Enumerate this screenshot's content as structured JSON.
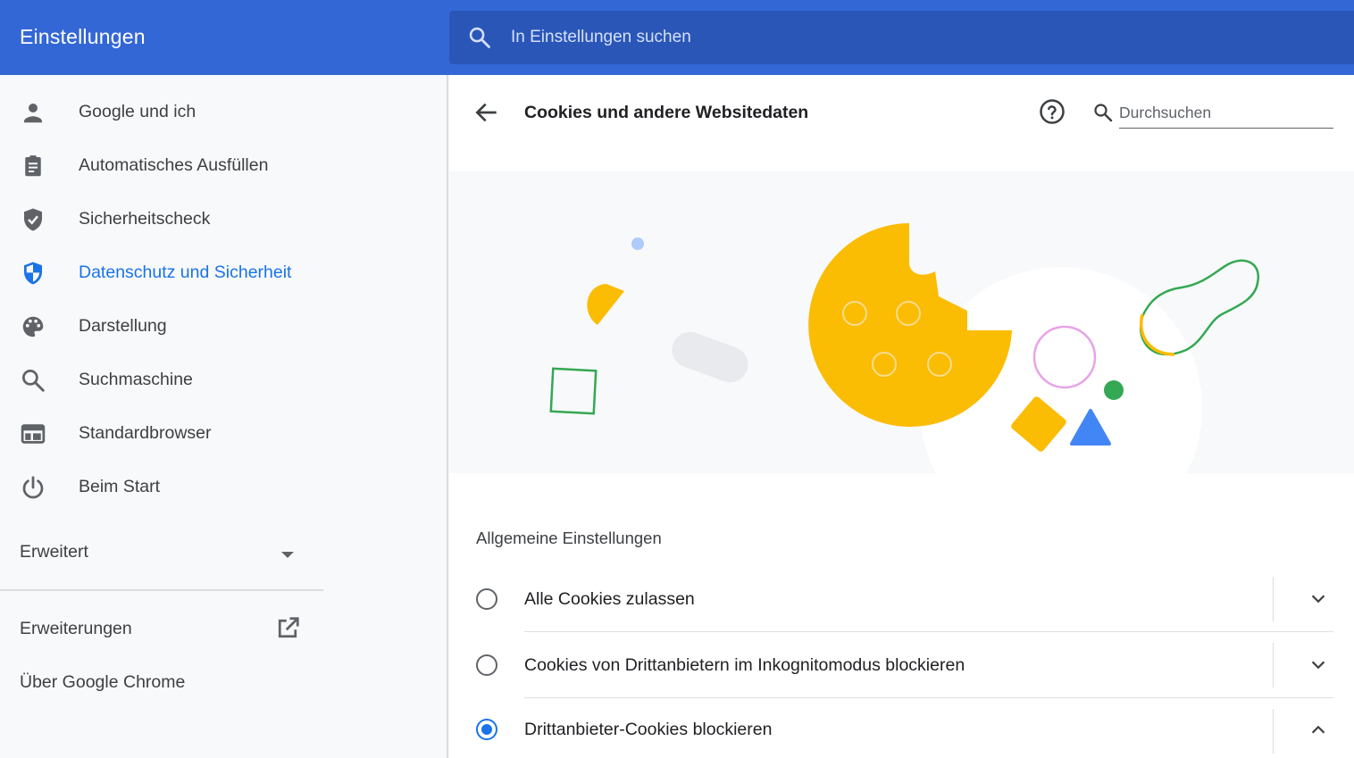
{
  "app": {
    "title": "Einstellungen"
  },
  "search": {
    "placeholder": "In Einstellungen suchen"
  },
  "sidebar": {
    "items": [
      {
        "label": "Google und ich",
        "icon": "person-icon"
      },
      {
        "label": "Automatisches Ausfüllen",
        "icon": "clipboard-icon"
      },
      {
        "label": "Sicherheitscheck",
        "icon": "shield-check-icon"
      },
      {
        "label": "Datenschutz und Sicherheit",
        "icon": "shield-half-icon",
        "active": true
      },
      {
        "label": "Darstellung",
        "icon": "palette-icon"
      },
      {
        "label": "Suchmaschine",
        "icon": "search-icon"
      },
      {
        "label": "Standardbrowser",
        "icon": "browser-window-icon"
      },
      {
        "label": "Beim Start",
        "icon": "power-icon"
      }
    ],
    "advanced": "Erweitert",
    "extensions": "Erweiterungen",
    "about": "Über Google Chrome"
  },
  "page": {
    "title": "Cookies und andere Websitedaten",
    "search_placeholder": "Durchsuchen"
  },
  "section": {
    "title": "Allgemeine Einstellungen",
    "options": [
      {
        "label": "Alle Cookies zulassen",
        "checked": false,
        "expanded": false
      },
      {
        "label": "Cookies von Drittanbietern im Inkognitomodus blockieren",
        "checked": false,
        "expanded": false
      },
      {
        "label": "Drittanbieter-Cookies blockieren",
        "checked": true,
        "expanded": true
      }
    ]
  },
  "colors": {
    "header": "#3367d6",
    "accent": "#1a73e8",
    "cookie": "#fbbc04",
    "green": "#34a853"
  }
}
